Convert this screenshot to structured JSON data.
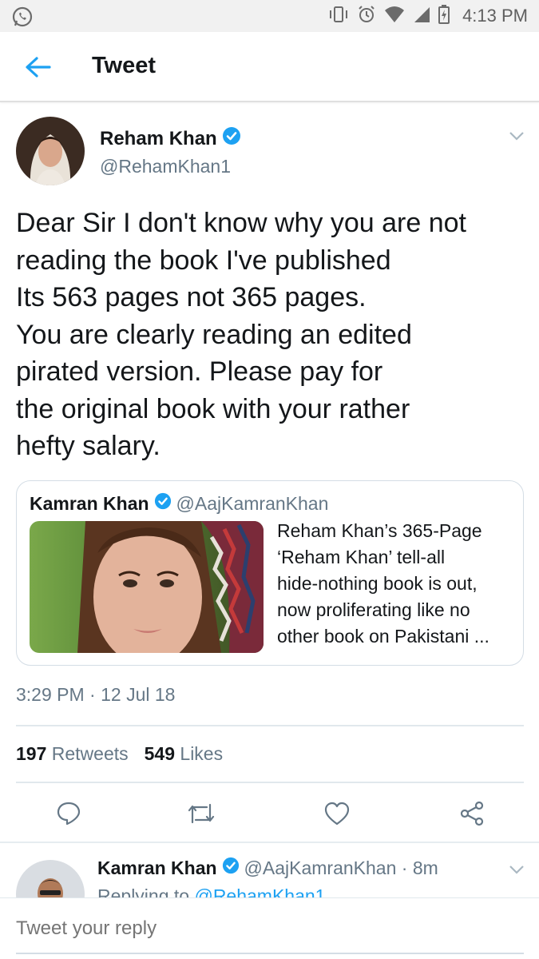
{
  "status_bar": {
    "time": "4:13 PM",
    "icons": [
      "whatsapp-icon",
      "vibrate-icon",
      "alarm-icon",
      "wifi-icon",
      "signal-icon",
      "battery-icon"
    ]
  },
  "app_bar": {
    "title": "Tweet",
    "back_icon": "arrow-left-icon"
  },
  "tweet": {
    "author_name": "Reham Khan",
    "author_handle": "@RehamKhan1",
    "text_lines": [
      "Dear Sir I don't know why you are not",
      "reading the book I've published",
      "Its 563 pages not 365 pages.",
      "You are clearly reading an edited",
      "pirated version. Please pay for",
      "the original book with your rather",
      "hefty salary."
    ],
    "quote": {
      "author_name": "Kamran Khan",
      "author_handle": "@AajKamranKhan",
      "text_lines": [
        "Reham Khan’s 365-Page",
        "‘Reham Khan’ tell-all",
        "hide-nothing book is out,",
        "now proliferating like no",
        "other book on Pakistani ..."
      ]
    },
    "timestamp": "3:29 PM · 12 Jul 18",
    "retweets_count": "197",
    "retweets_label": "Retweets",
    "likes_count": "549",
    "likes_label": "Likes"
  },
  "reply_preview": {
    "author_name": "Kamran Khan",
    "author_handle": "@AajKamranKhan · 8m",
    "replying_prefix": "Replying to ",
    "replying_to": "@RehamKhan1"
  },
  "reply_bar": {
    "placeholder": "Tweet your reply"
  },
  "colors": {
    "accent": "#1da1f2",
    "text": "#14171a",
    "secondary": "#657786",
    "border": "#e1e8ed"
  }
}
